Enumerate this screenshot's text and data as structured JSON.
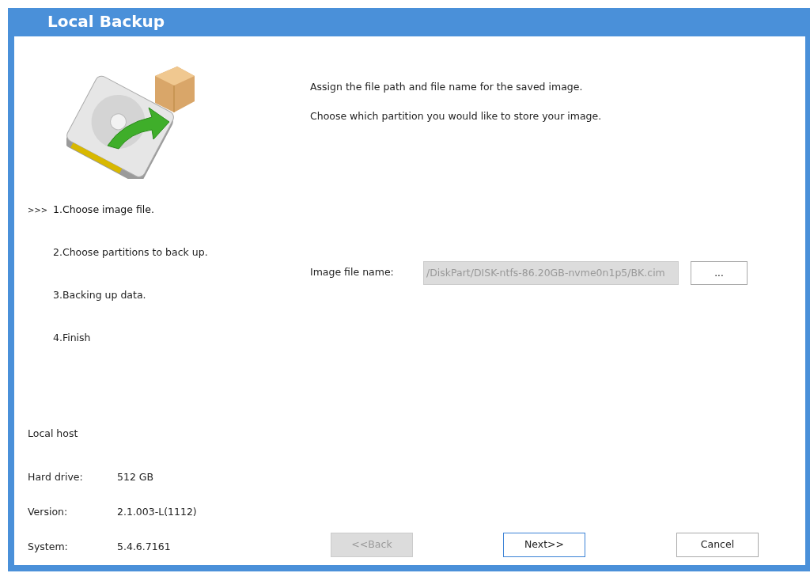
{
  "window": {
    "title": "Local Backup"
  },
  "steps": {
    "current_marker": ">>>",
    "items": [
      {
        "label": "1.Choose image file.",
        "current": true
      },
      {
        "label": "2.Choose partitions to back up.",
        "current": false
      },
      {
        "label": "3.Backing up data.",
        "current": false
      },
      {
        "label": "4.Finish",
        "current": false
      }
    ]
  },
  "host_info": {
    "title": "Local host",
    "rows": [
      {
        "label": "Hard drive:",
        "value": "512 GB"
      },
      {
        "label": "Version:",
        "value": "2.1.003-L(1112)"
      },
      {
        "label": "System:",
        "value": "5.4.6.7161"
      }
    ]
  },
  "instructions": [
    "Assign the file path and file name for the saved image.",
    "Choose which partition you would like to store your image."
  ],
  "image_file": {
    "label": "Image file name:",
    "value": "/DiskPart/DISK-ntfs-86.20GB-nvme0n1p5/BK.cim",
    "disabled": true,
    "browse_button": "..."
  },
  "buttons": [
    {
      "label": "<<Back",
      "disabled": true,
      "focused": false
    },
    {
      "label": "Next>>",
      "disabled": false,
      "focused": true
    },
    {
      "label": "Cancel",
      "disabled": false,
      "focused": false
    }
  ]
}
